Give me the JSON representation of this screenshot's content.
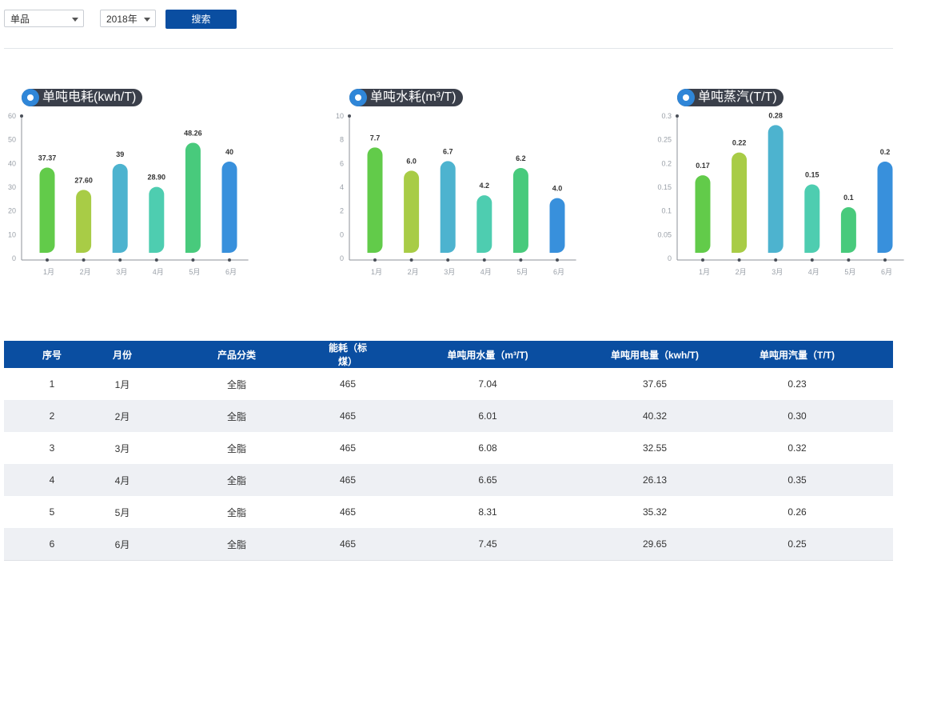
{
  "filters": {
    "product": {
      "value": "单品"
    },
    "year": {
      "value": "2018年"
    },
    "search_label": "搜索"
  },
  "chart_data": [
    {
      "type": "bar",
      "title": "单吨电耗(kwh/T)",
      "categories": [
        "1月",
        "2月",
        "3月",
        "4月",
        "5月",
        "6月"
      ],
      "values": [
        37.37,
        27.6,
        39,
        28.9,
        48.26,
        40
      ],
      "value_labels": [
        "37.37",
        "27.60",
        "39",
        "28.90",
        "48.26",
        "40"
      ],
      "yticks": [
        "0",
        "10",
        "20",
        "30",
        "40",
        "50",
        "60"
      ],
      "ylim": [
        0,
        60
      ],
      "colors": [
        "#62cb4a",
        "#a8cc46",
        "#4db3cf",
        "#4ecdb0",
        "#48ca7c",
        "#3890dc"
      ]
    },
    {
      "type": "bar",
      "title": "单吨水耗(m³/T)",
      "categories": [
        "1月",
        "2月",
        "3月",
        "4月",
        "5月",
        "6月"
      ],
      "values": [
        7.7,
        6.0,
        6.7,
        4.2,
        6.2,
        4.0
      ],
      "value_labels": [
        "7.7",
        "6.0",
        "6.7",
        "4.2",
        "6.2",
        "4.0"
      ],
      "yticks": [
        "0",
        "0",
        "2",
        "4",
        "6",
        "8",
        "10"
      ],
      "ylim": [
        0,
        10
      ],
      "colors": [
        "#62cb4a",
        "#a8cc46",
        "#4db3cf",
        "#4ecdb0",
        "#48ca7c",
        "#3890dc"
      ]
    },
    {
      "type": "bar",
      "title": "单吨蒸汽(T/T)",
      "categories": [
        "1月",
        "2月",
        "3月",
        "4月",
        "5月",
        "6月"
      ],
      "values": [
        0.17,
        0.22,
        0.28,
        0.15,
        0.1,
        0.2
      ],
      "value_labels": [
        "0.17",
        "0.22",
        "0.28",
        "0.15",
        "0.1",
        "0.2"
      ],
      "yticks": [
        "0",
        "0.05",
        "0.1",
        "0.15",
        "0.2",
        "0.25",
        "0.3"
      ],
      "ylim": [
        0,
        0.3
      ],
      "colors": [
        "#62cb4a",
        "#a8cc46",
        "#4db3cf",
        "#4ecdb0",
        "#48ca7c",
        "#3890dc"
      ]
    }
  ],
  "table": {
    "headers": [
      "序号",
      "月份",
      "产品分类",
      "能耗（标煤）",
      "单吨用水量（m³/T)",
      "单吨用电量（kwh/T)",
      "单吨用汽量（T/T)"
    ],
    "rows": [
      [
        "1",
        "1月",
        "全脂",
        "465",
        "7.04",
        "37.65",
        "0.23"
      ],
      [
        "2",
        "2月",
        "全脂",
        "465",
        "6.01",
        "40.32",
        "0.30"
      ],
      [
        "3",
        "3月",
        "全脂",
        "465",
        "6.08",
        "32.55",
        "0.32"
      ],
      [
        "4",
        "4月",
        "全脂",
        "465",
        "6.65",
        "26.13",
        "0.35"
      ],
      [
        "5",
        "5月",
        "全脂",
        "465",
        "8.31",
        "35.32",
        "0.26"
      ],
      [
        "6",
        "6月",
        "全脂",
        "465",
        "7.45",
        "29.65",
        "0.25"
      ]
    ]
  }
}
